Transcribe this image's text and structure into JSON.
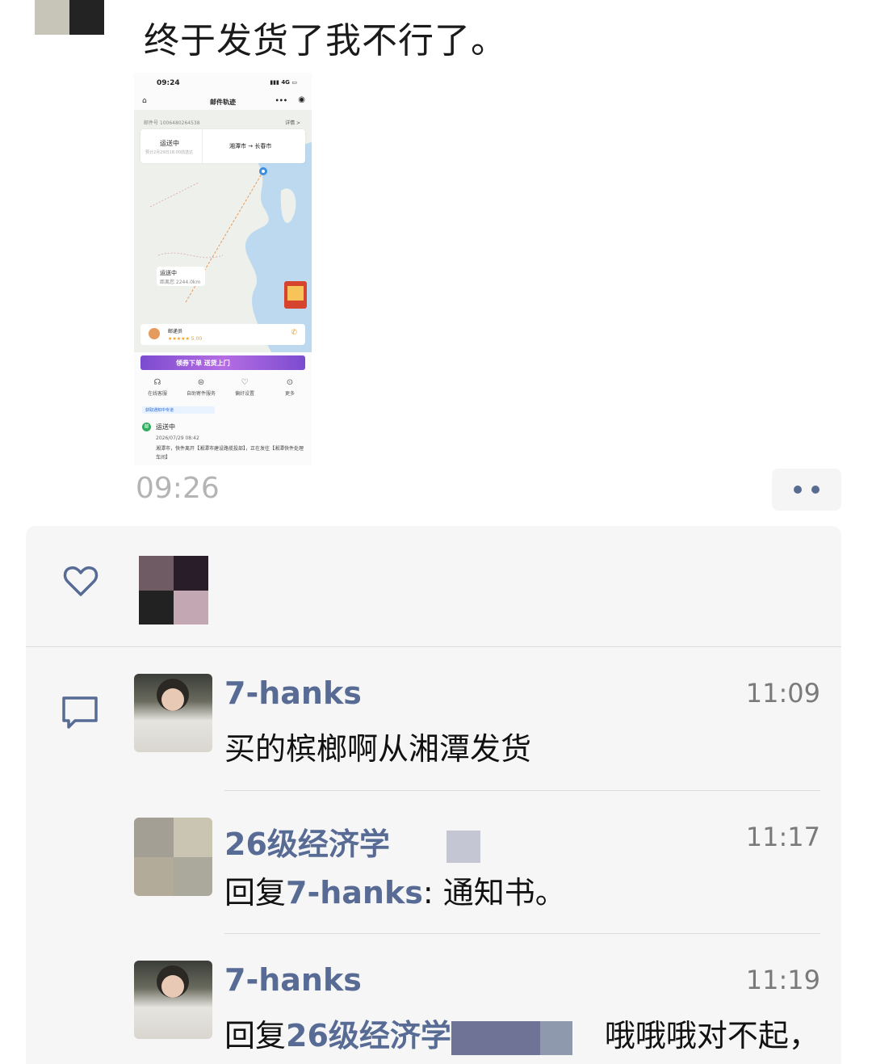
{
  "post": {
    "text": "终于发货了我不行了。",
    "time": "09:26"
  },
  "screenshot": {
    "status_time": "09:24",
    "status_signal": "4G",
    "nav_title": "邮件轨迹",
    "tracking_no": "邮件号 1006480264538",
    "detail_link": "详情 >",
    "status": "运送中",
    "status_sub": "预计2月29日18:00前送达",
    "route_from": "湘潭市",
    "route_to": "长春市",
    "map_bubble_status": "运送中",
    "map_bubble_distance": "距离您 2244.0km",
    "courier_name": "邮递员",
    "courier_rating": "★★★★★ 5.00",
    "banner": "领券下单 送货上门",
    "icons": [
      {
        "icon": "headset-icon",
        "label": "在线客服"
      },
      {
        "icon": "service-icon",
        "label": "自助寄件服务"
      },
      {
        "icon": "pref-icon",
        "label": "偏好设置"
      },
      {
        "icon": "more-icon",
        "label": "更多"
      }
    ],
    "notice_pill": "获取通知中专道",
    "event_status": "运送中",
    "event_date": "2026/07/29 08:42",
    "event_text": "湘潭市，快件离开【湘潭市建设路揽投部】，正在发往【湘潭快件处理车间】"
  },
  "likes": {
    "heart_icon": "heart-icon"
  },
  "comments": [
    {
      "name": "7-hanks",
      "time": "11:09",
      "text": "买的槟榔啊从湘潭发货"
    },
    {
      "name": "26级经济学",
      "time": "11:17",
      "reply_prefix": "回复",
      "reply_to": "7-hanks",
      "text": ": 通知书。"
    },
    {
      "name": "7-hanks",
      "time": "11:19",
      "reply_prefix": "回复",
      "reply_to": "26级经济学",
      "text": "哦哦哦对不起，"
    }
  ],
  "colors": {
    "link": "#576b95",
    "panel_bg": "#f6f6f6",
    "time_gray": "#b4b4b4"
  }
}
